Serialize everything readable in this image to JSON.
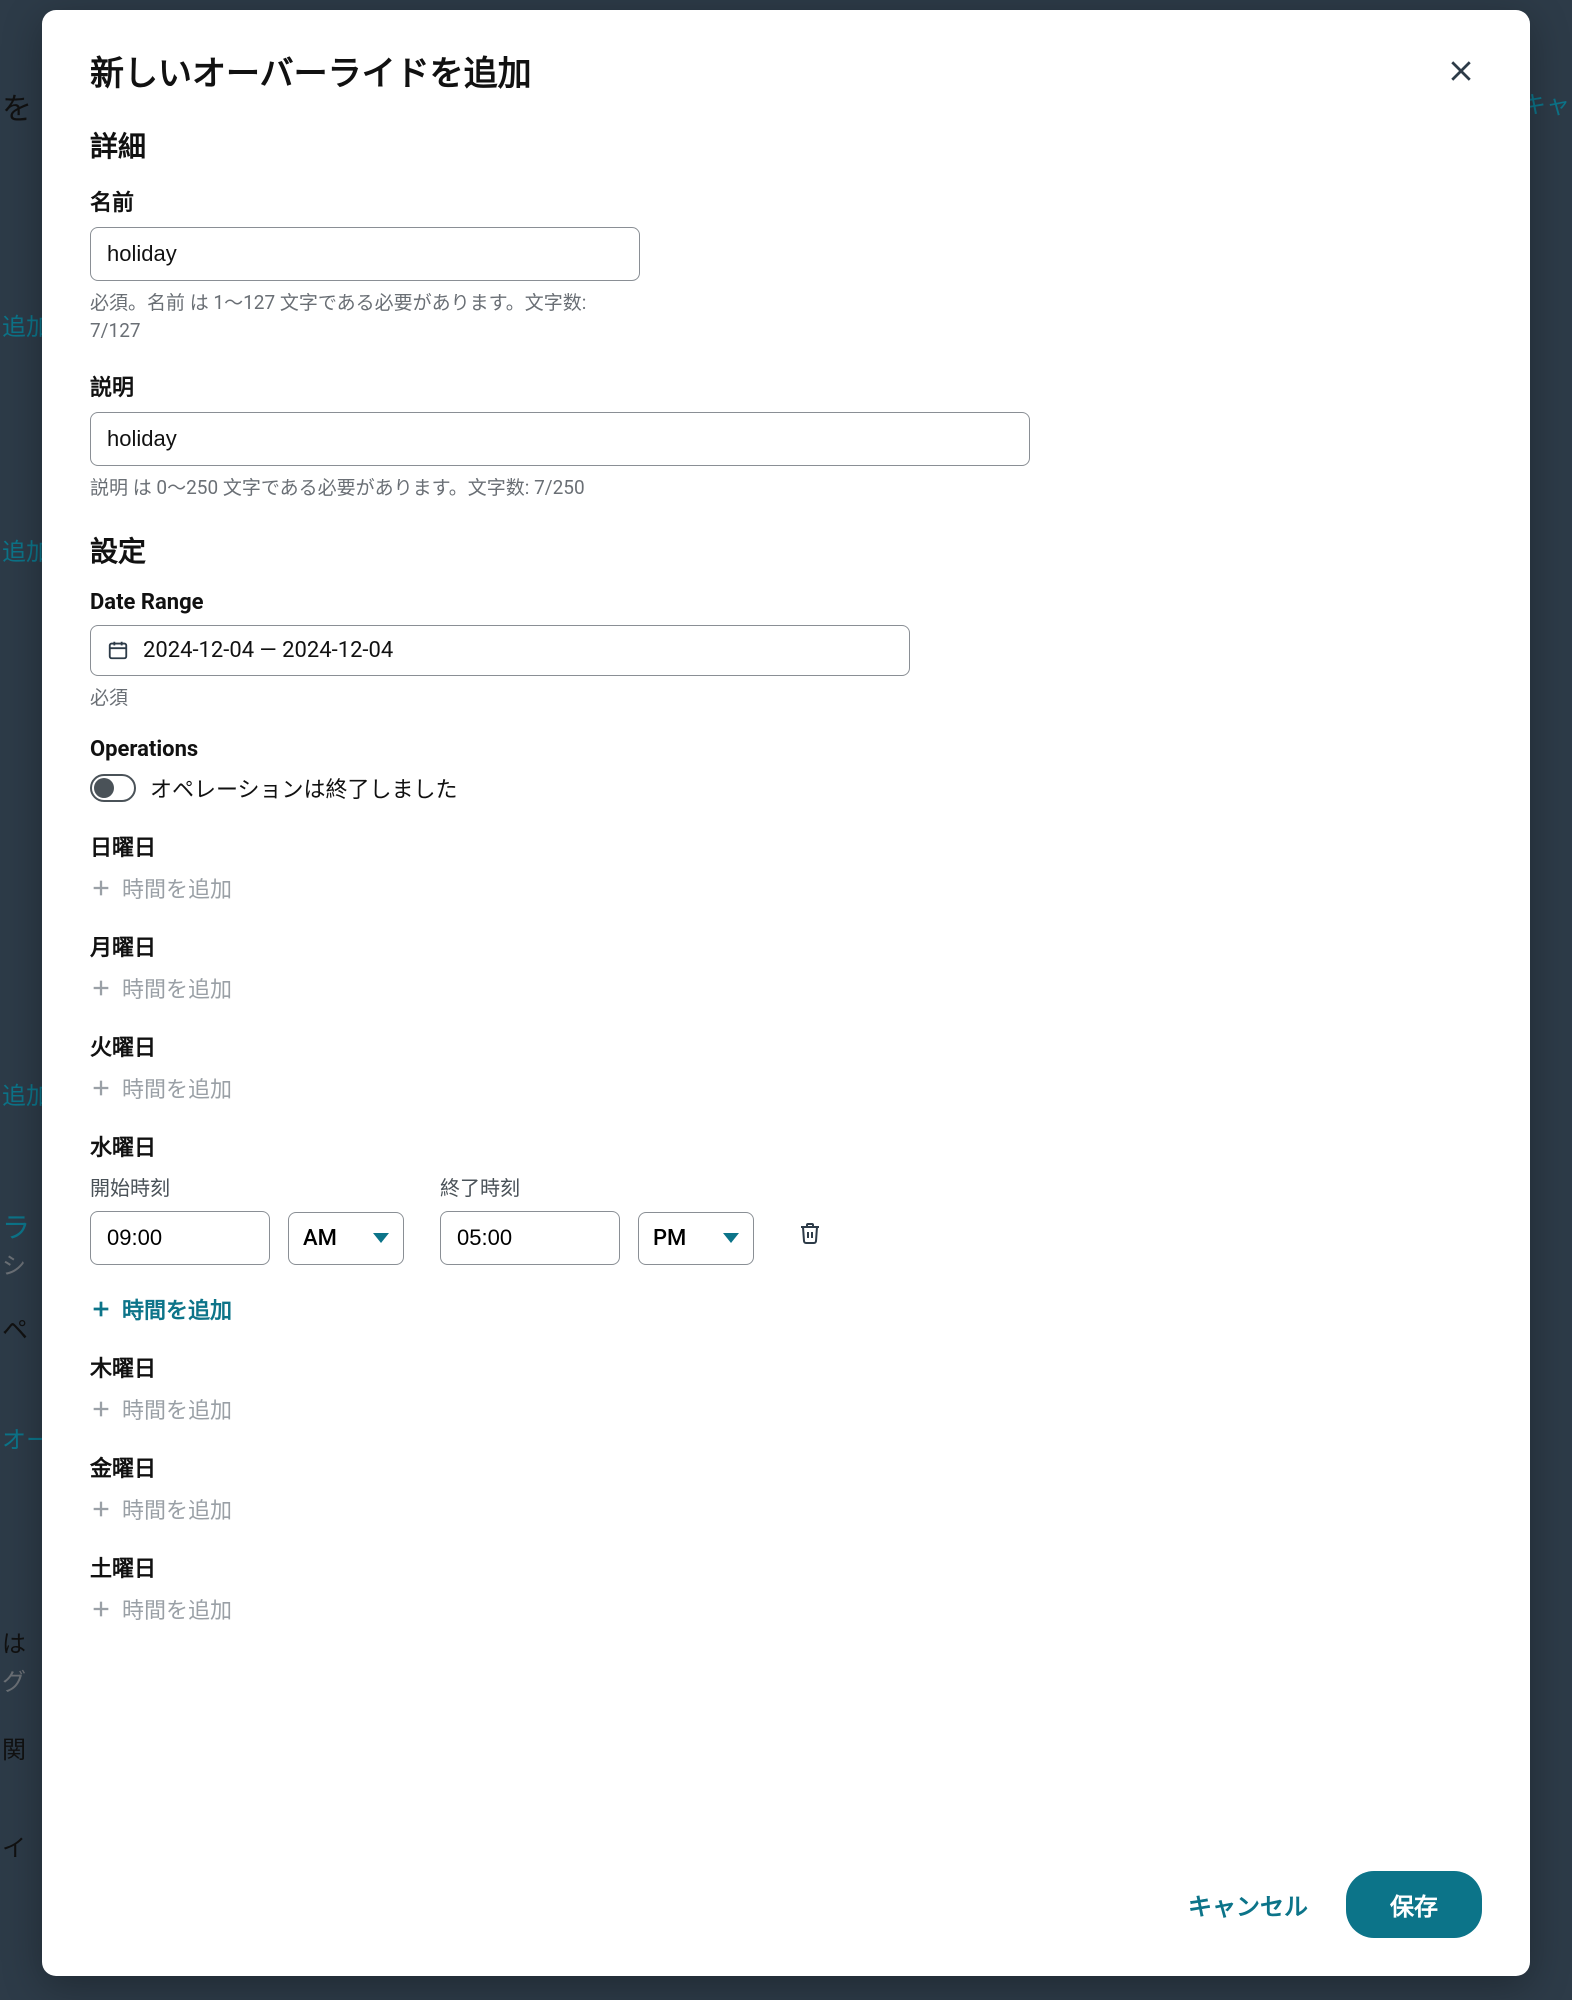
{
  "modal": {
    "title": "新しいオーバーライドを追加",
    "sections": {
      "details": "詳細",
      "settings": "設定"
    },
    "name": {
      "label": "名前",
      "value": "holiday",
      "hint": "必須。名前 は 1〜127 文字である必要があります。文字数: 7/127"
    },
    "description": {
      "label": "説明",
      "value": "holiday",
      "hint": "説明 は 0〜250 文字である必要があります。文字数: 7/250"
    },
    "dateRange": {
      "label": "Date Range",
      "value": "2024-12-04 — 2024-12-04",
      "hint": "必須"
    },
    "operations": {
      "label": "Operations",
      "toggleLabel": "オペレーションは終了しました"
    },
    "addTimeLabel": "時間を追加",
    "days": {
      "sun": "日曜日",
      "mon": "月曜日",
      "tue": "火曜日",
      "wed": "水曜日",
      "thu": "木曜日",
      "fri": "金曜日",
      "sat": "土曜日"
    },
    "wednesday": {
      "startLabel": "開始時刻",
      "endLabel": "終了時刻",
      "startTime": "09:00",
      "startPeriod": "AM",
      "endTime": "05:00",
      "endPeriod": "PM"
    },
    "footer": {
      "cancel": "キャンセル",
      "save": "保存"
    }
  },
  "bg": {
    "t1": "追加",
    "t2": "追加",
    "t3": "追加",
    "t4": "ラ",
    "t5": "シ",
    "t6": "ペ",
    "t7": "オー",
    "t8": "キャ",
    "t9": "イ",
    "t10": "を",
    "t11": "関",
    "t12": "は",
    "t13": "グ"
  }
}
